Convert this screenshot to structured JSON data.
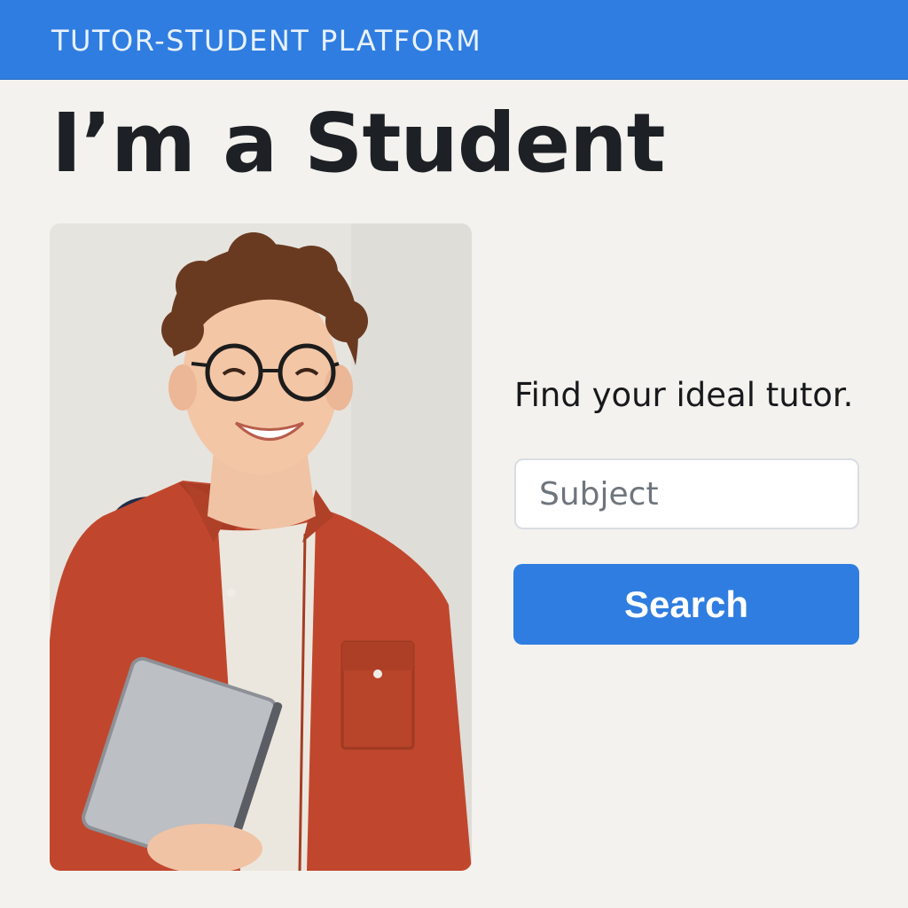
{
  "header": {
    "brand": "TUTOR-STUDENT PLATFORM",
    "color": "#2f7de0"
  },
  "page": {
    "title": "I’m a Student"
  },
  "hero": {
    "image": "smiling-student-photo"
  },
  "search": {
    "tagline": "Find your ideal tutor.",
    "subject_placeholder": "Subject",
    "subject_value": "",
    "button_label": "Search",
    "button_color": "#2f7de0"
  }
}
